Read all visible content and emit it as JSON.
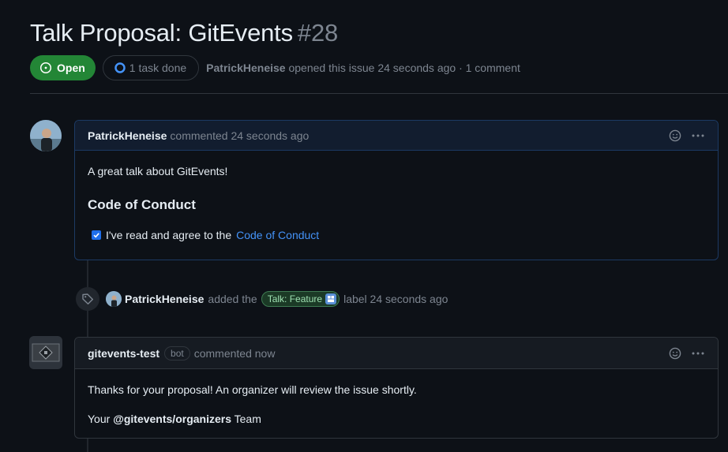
{
  "issue": {
    "title": "Talk Proposal: GitEvents",
    "number": "#28",
    "state": "Open",
    "tasks": "1 task done",
    "author": "PatrickHeneise",
    "opened_text": "opened this issue 24 seconds ago · 1 comment"
  },
  "comment1": {
    "author": "PatrickHeneise",
    "time": "commented 24 seconds ago",
    "intro": "A great talk about GitEvents!",
    "heading": "Code of Conduct",
    "task_text": "I've read and agree to the",
    "task_link": "Code of Conduct"
  },
  "label_event": {
    "actor": "PatrickHeneise",
    "added": "added the",
    "label_name": "Talk: Feature",
    "suffix": "label 24 seconds ago"
  },
  "comment2": {
    "author": "gitevents-test",
    "bot_tag": "bot",
    "time": "commented now",
    "line1": "Thanks for your proposal! An organizer will review the issue shortly.",
    "line2_prefix": "Your",
    "line2_mention": "@gitevents/organizers",
    "line2_suffix": "Team"
  },
  "colors": {
    "open_green": "#238636",
    "link_blue": "#4493f8",
    "background": "#0d1117",
    "label_fg": "#9ee0b1"
  }
}
